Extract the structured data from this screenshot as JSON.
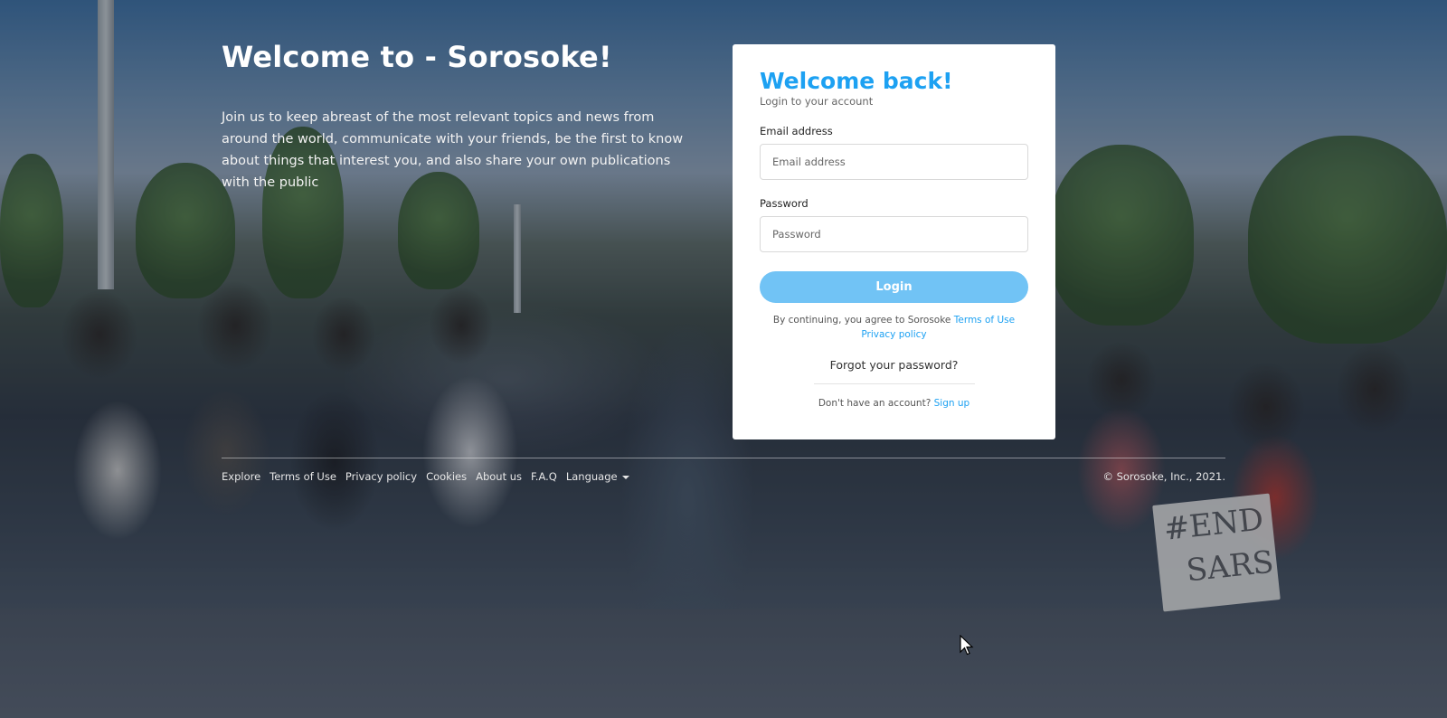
{
  "hero": {
    "title": "Welcome to - Sorosoke!",
    "description": "Join us to keep abreast of the most relevant topics and news from around the world, communicate with your friends, be the first to know about things that interest you, and also share your own publications with the public"
  },
  "login": {
    "heading": "Welcome back!",
    "subheading": "Login to your account",
    "email_label": "Email address",
    "email_placeholder": "Email address",
    "password_label": "Password",
    "password_placeholder": "Password",
    "submit_label": "Login",
    "terms_prefix": "By continuing, you agree to Sorosoke ",
    "terms_link": "Terms of Use",
    "privacy_link": "Privacy policy",
    "forgot_label": "Forgot your password?",
    "signup_prefix": "Don't have an account? ",
    "signup_link": "Sign up"
  },
  "footer": {
    "links": [
      "Explore",
      "Terms of Use",
      "Privacy policy",
      "Cookies",
      "About us",
      "F.A.Q"
    ],
    "language_label": "Language",
    "copyright": "© Sorosoke, Inc., 2021."
  },
  "background": {
    "sign_lines": [
      "#END",
      "SARS"
    ]
  },
  "colors": {
    "accent": "#1da1f2",
    "button": "#71c3f5"
  }
}
